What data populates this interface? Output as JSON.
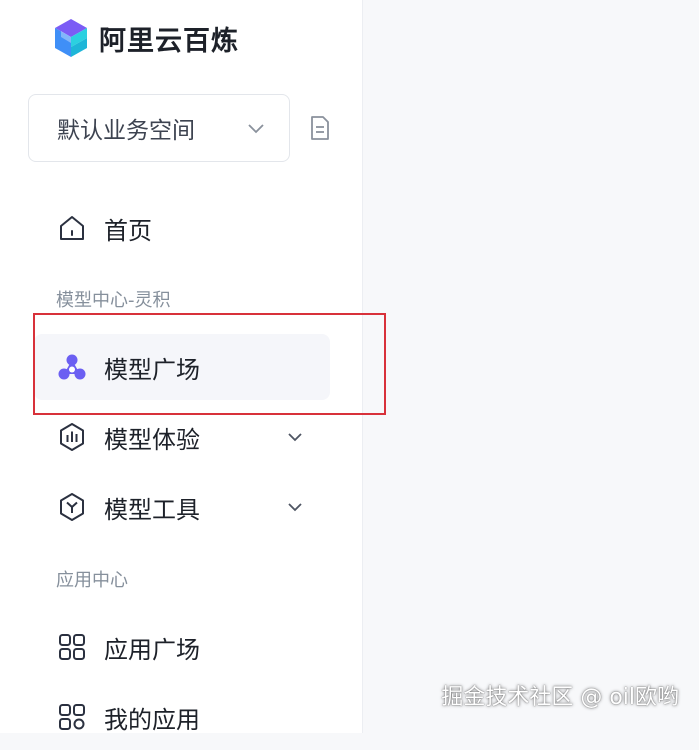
{
  "brand": {
    "name": "阿里云百炼",
    "logo_icon": "bailian-cube-logo"
  },
  "workspace": {
    "label": "默认业务空间",
    "icon": "chevron-down-icon"
  },
  "doc_button": {
    "icon": "document-icon"
  },
  "nav": {
    "home": {
      "label": "首页",
      "icon": "home-icon"
    },
    "section_model_center": "模型中心-灵积",
    "model_square": {
      "label": "模型广场",
      "icon": "model-square-icon",
      "active": true
    },
    "model_experience": {
      "label": "模型体验",
      "icon": "chart-hexagon-icon"
    },
    "model_tools": {
      "label": "模型工具",
      "icon": "tool-hexagon-icon"
    },
    "section_app_center": "应用中心",
    "app_square": {
      "label": "应用广场",
      "icon": "grid-icon"
    },
    "my_apps": {
      "label": "我的应用",
      "icon": "apps-icon"
    }
  },
  "colors": {
    "accent": "#6b5ff2",
    "highlight_border": "#d8313a",
    "text": "#1d2129",
    "muted": "#86909c"
  },
  "watermark": "掘金技术社区 @ oil欧哟"
}
